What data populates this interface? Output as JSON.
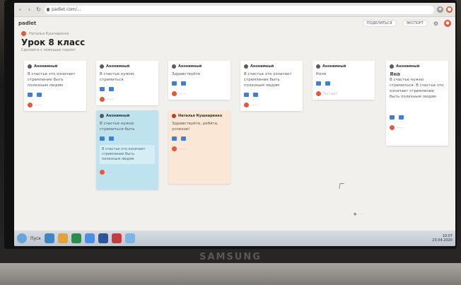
{
  "browser": {
    "url": "padlet.com/...",
    "extensions": [
      {
        "icon": "star-icon",
        "color": "#9a9a9a"
      },
      {
        "icon": "profile-icon",
        "color": "#d9542f"
      }
    ]
  },
  "topbar": {
    "logo": "padlet",
    "actions": [
      "ПОДЕЛИТЬСЯ",
      "ЭКСПОРТ"
    ]
  },
  "header": {
    "author": "Наталья Кушнаренко",
    "title": "Урок 8 класс",
    "subtitle": "Сделайте с помощью падлет"
  },
  "cards": [
    {
      "author": "Анонимный",
      "time": "",
      "body": "В счастье это означает стремление быть полезным людям",
      "likes": "",
      "comments": "",
      "color": "white"
    },
    {
      "author": "Анонимный",
      "time": "",
      "body": "В счастье нужно стремиться",
      "likes": "",
      "comments": "",
      "color": "white"
    },
    {
      "author": "Анонимный",
      "time": "",
      "body": "Здравствуйте",
      "likes": "",
      "comments": "",
      "color": "white"
    },
    {
      "author": "Анонимный",
      "time": "",
      "body": "В счастье это означает стремление быть полезным людям",
      "likes": "",
      "comments": "",
      "color": "white"
    },
    {
      "author": "Анонимный",
      "time": "",
      "body": "Коля",
      "likes": "",
      "comments": "Ты где?",
      "color": "white"
    },
    {
      "author": "Анонимный",
      "time": "",
      "body": "Яна",
      "body2": "В счастье нужно стремиться. В счастье это означает стремление быть полезным людям",
      "likes": "",
      "comments": "",
      "color": "white"
    },
    {
      "author": "Анонимный",
      "time": "",
      "body": "В счастье нужно стремиться быть",
      "likes": "",
      "comments": "",
      "reply": "В счастье это означает стремление быть полезным людям",
      "color": "blue"
    },
    {
      "author": "Наталья Кушнаренко",
      "time": "",
      "body": "Здравствуйте, ребята, успехов!",
      "likes": "",
      "comments": "",
      "reply": "",
      "color": "peach"
    }
  ],
  "taskbar": {
    "start": "Пуск",
    "time": "10:07",
    "date": "23.04.2020"
  },
  "laptop": {
    "brand": "SAMSUNG"
  }
}
